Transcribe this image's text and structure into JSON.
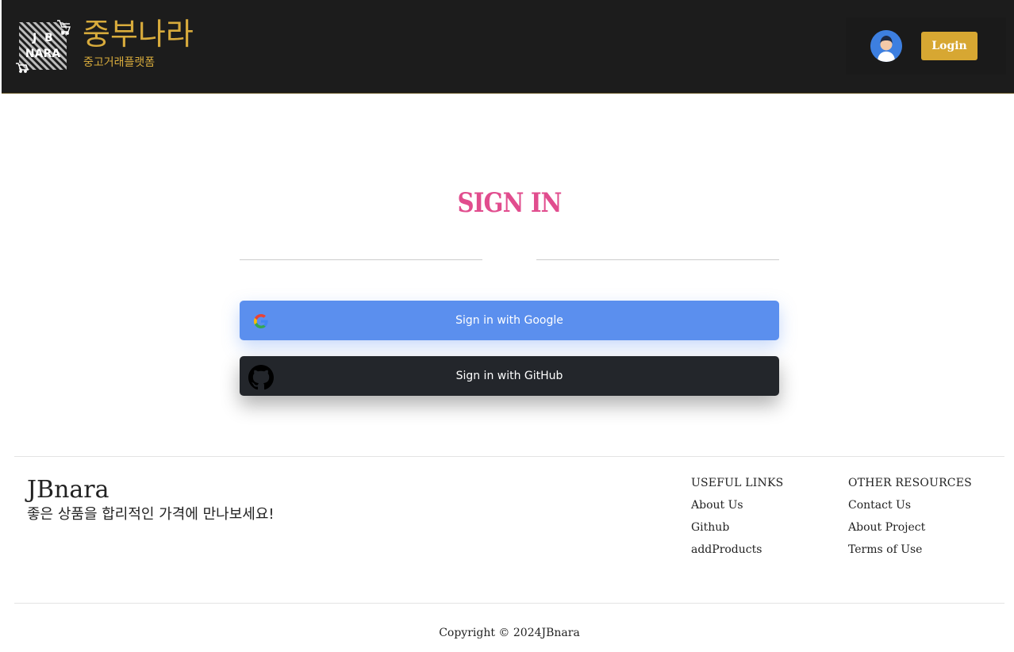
{
  "header": {
    "logo_text": "JB NARA",
    "brand_title": "중부나라",
    "brand_subtitle": "중고거래플랫폼",
    "avatar_icon": "user-avatar-icon",
    "login_label": "Login",
    "colors": {
      "background": "#1c1c1c",
      "accent": "#d8ab3c",
      "login_button": "#d7a732",
      "avatar": "#3d7fe0"
    }
  },
  "signin": {
    "title": "SIGN IN",
    "title_color": "#e14d8e",
    "google_label": "Sign in with Google",
    "google_icon": "google-icon",
    "google_color": "#5b8fee",
    "github_label": "Sign in with GitHub",
    "github_icon": "github-icon",
    "github_color": "#23262b"
  },
  "footer": {
    "brand": "JBnara",
    "tagline": "좋은 상품을 합리적인 가격에 만나보세요!",
    "useful_links": {
      "heading": "USEFUL LINKS",
      "items": [
        "About Us",
        "Github",
        "addProducts"
      ]
    },
    "other_resources": {
      "heading": "OTHER RESOURCES",
      "items": [
        "Contact Us",
        "About Project",
        "Terms of Use"
      ]
    },
    "copyright": "Copyright © 2024JBnara"
  }
}
